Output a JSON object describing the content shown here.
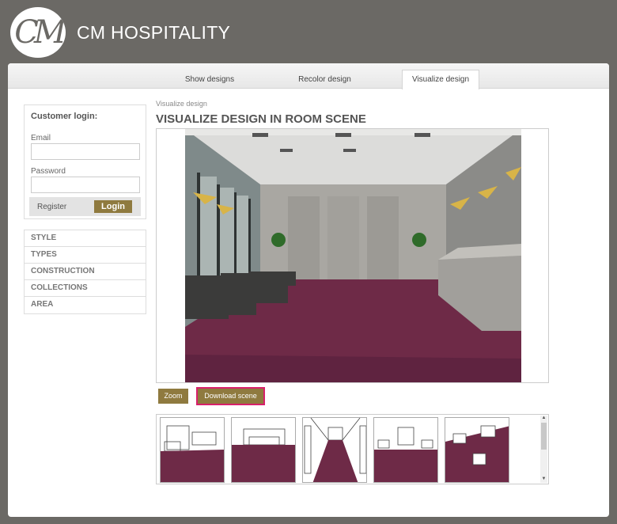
{
  "brand": {
    "logo_text": "CM",
    "name": "CM HOSPITALITY"
  },
  "tabs": [
    {
      "label": "Show designs"
    },
    {
      "label": "Recolor design"
    },
    {
      "label": "Visualize design"
    }
  ],
  "login": {
    "title": "Customer login:",
    "email_label": "Email",
    "email_value": "",
    "password_label": "Password",
    "password_value": "",
    "register_label": "Register",
    "login_label": "Login"
  },
  "menu": [
    "STYLE",
    "TYPES",
    "CONSTRUCTION",
    "COLLECTIONS",
    "AREA"
  ],
  "breadcrumb": "Visualize design",
  "page_title": "VISUALIZE DESIGN IN ROOM SCENE",
  "actions": {
    "zoom_label": "Zoom",
    "download_label": "Download scene"
  },
  "colors": {
    "accent": "#8f7a3f",
    "carpet": "#6e2a47",
    "highlight": "#d8206b",
    "background": "#6b6965"
  }
}
